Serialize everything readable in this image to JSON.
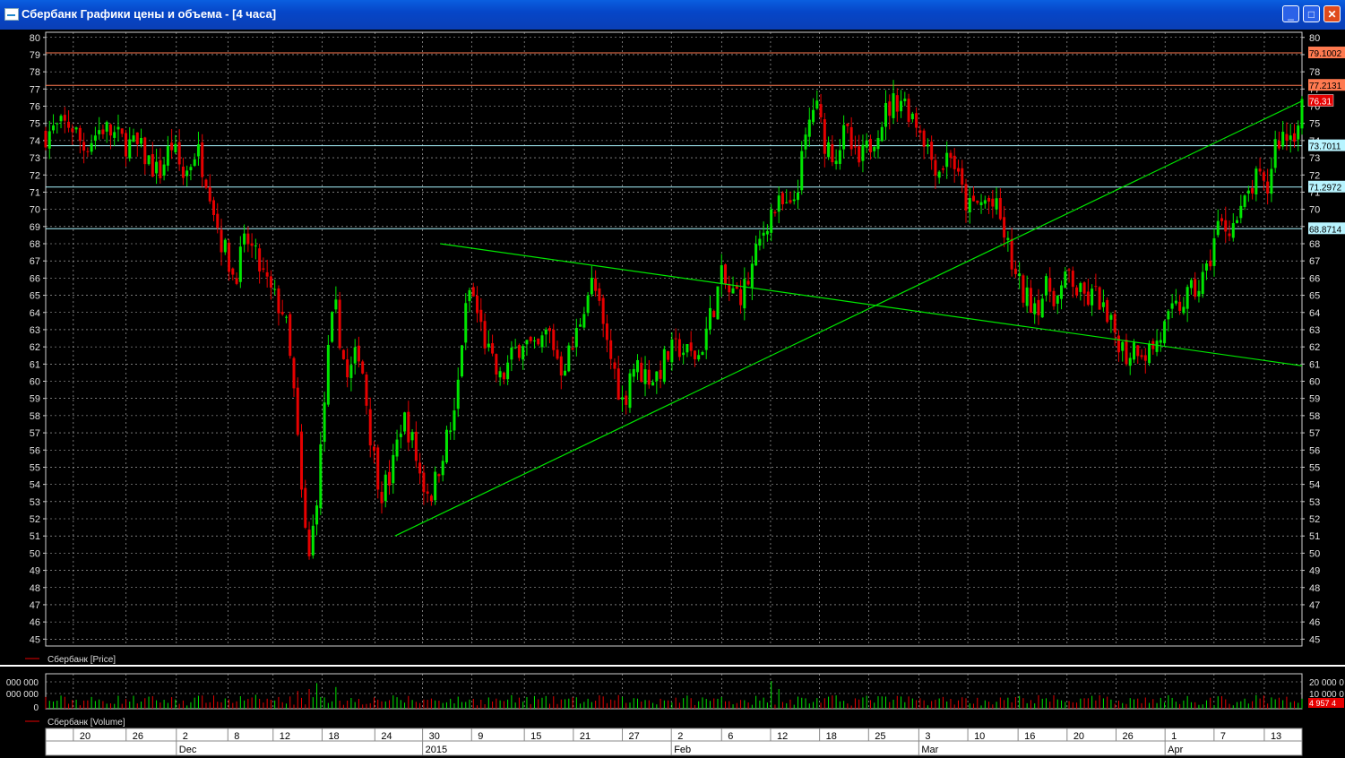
{
  "window": {
    "title": "Сбербанк Графики цены и объема - [4 часа]"
  },
  "colors": {
    "up": "#00e600",
    "down": "#e60000",
    "trendline": "#00e600",
    "grid": "#c0c0c0",
    "resistance": "#ff7a50",
    "support": "#aaf5ff"
  },
  "chart_data": [
    {
      "type": "candlestick",
      "series_name": "Сбербанк [Price]",
      "ylim": [
        44.6,
        80.3
      ],
      "y_ticks": [
        45,
        46,
        47,
        48,
        49,
        50,
        51,
        52,
        53,
        54,
        55,
        56,
        57,
        58,
        59,
        60,
        61,
        62,
        63,
        64,
        65,
        66,
        67,
        68,
        69,
        70,
        71,
        72,
        73,
        74,
        75,
        76,
        77,
        78,
        79,
        80
      ],
      "x_ticks": [
        {
          "label": "20",
          "sub": "",
          "frac": 0.022
        },
        {
          "label": "26",
          "sub": "",
          "frac": 0.064
        },
        {
          "label": "2",
          "sub": "Dec",
          "frac": 0.104
        },
        {
          "label": "8",
          "sub": "",
          "frac": 0.145
        },
        {
          "label": "12",
          "sub": "",
          "frac": 0.181
        },
        {
          "label": "18",
          "sub": "",
          "frac": 0.22
        },
        {
          "label": "24",
          "sub": "",
          "frac": 0.262
        },
        {
          "label": "30",
          "sub": "2015",
          "frac": 0.3
        },
        {
          "label": "9",
          "sub": "",
          "frac": 0.339
        },
        {
          "label": "15",
          "sub": "",
          "frac": 0.381
        },
        {
          "label": "21",
          "sub": "",
          "frac": 0.42
        },
        {
          "label": "27",
          "sub": "",
          "frac": 0.459
        },
        {
          "label": "2",
          "sub": "Feb",
          "frac": 0.498
        },
        {
          "label": "6",
          "sub": "",
          "frac": 0.538
        },
        {
          "label": "12",
          "sub": "",
          "frac": 0.577
        },
        {
          "label": "18",
          "sub": "",
          "frac": 0.616
        },
        {
          "label": "25",
          "sub": "",
          "frac": 0.655
        },
        {
          "label": "3",
          "sub": "Mar",
          "frac": 0.695
        },
        {
          "label": "10",
          "sub": "",
          "frac": 0.734
        },
        {
          "label": "16",
          "sub": "",
          "frac": 0.774
        },
        {
          "label": "20",
          "sub": "",
          "frac": 0.813
        },
        {
          "label": "26",
          "sub": "",
          "frac": 0.852
        },
        {
          "label": "1",
          "sub": "Apr",
          "frac": 0.891
        },
        {
          "label": "7",
          "sub": "",
          "frac": 0.93
        },
        {
          "label": "13",
          "sub": "",
          "frac": 0.97
        }
      ],
      "path_points": [
        [
          0,
          74.4
        ],
        [
          0.02,
          75
        ],
        [
          0.03,
          73.6
        ],
        [
          0.045,
          74.8
        ],
        [
          0.06,
          74
        ],
        [
          0.075,
          73.5
        ],
        [
          0.09,
          72
        ],
        [
          0.1,
          73.8
        ],
        [
          0.11,
          71.8
        ],
        [
          0.12,
          73.6
        ],
        [
          0.13,
          71.5
        ],
        [
          0.138,
          68.6
        ],
        [
          0.15,
          66
        ],
        [
          0.16,
          68.3
        ],
        [
          0.18,
          65
        ],
        [
          0.19,
          64
        ],
        [
          0.198,
          59
        ],
        [
          0.205,
          52
        ],
        [
          0.21,
          49.5
        ],
        [
          0.218,
          55
        ],
        [
          0.224,
          61
        ],
        [
          0.23,
          64.5
        ],
        [
          0.24,
          60
        ],
        [
          0.25,
          62
        ],
        [
          0.26,
          56
        ],
        [
          0.267,
          53.6
        ],
        [
          0.275,
          54.5
        ],
        [
          0.284,
          58
        ],
        [
          0.29,
          57
        ],
        [
          0.3,
          54
        ],
        [
          0.308,
          53.5
        ],
        [
          0.316,
          56
        ],
        [
          0.326,
          58
        ],
        [
          0.332,
          63
        ],
        [
          0.338,
          65.5
        ],
        [
          0.345,
          63.5
        ],
        [
          0.355,
          61
        ],
        [
          0.362,
          60
        ],
        [
          0.372,
          61.5
        ],
        [
          0.38,
          62.5
        ],
        [
          0.39,
          61.5
        ],
        [
          0.4,
          63
        ],
        [
          0.41,
          60.8
        ],
        [
          0.42,
          62
        ],
        [
          0.43,
          65
        ],
        [
          0.436,
          65.8
        ],
        [
          0.445,
          62.5
        ],
        [
          0.452,
          60.8
        ],
        [
          0.46,
          58.5
        ],
        [
          0.466,
          61
        ],
        [
          0.475,
          60.5
        ],
        [
          0.485,
          60.2
        ],
        [
          0.495,
          61.5
        ],
        [
          0.505,
          62
        ],
        [
          0.512,
          61.5
        ],
        [
          0.52,
          61.5
        ],
        [
          0.53,
          64
        ],
        [
          0.538,
          66
        ],
        [
          0.545,
          65
        ],
        [
          0.555,
          65.2
        ],
        [
          0.56,
          66
        ],
        [
          0.568,
          68
        ],
        [
          0.576,
          69.8
        ],
        [
          0.585,
          70.2
        ],
        [
          0.593,
          69.8
        ],
        [
          0.6,
          72
        ],
        [
          0.607,
          74.8
        ],
        [
          0.612,
          76.3
        ],
        [
          0.62,
          74
        ],
        [
          0.628,
          73.2
        ],
        [
          0.637,
          74.5
        ],
        [
          0.646,
          72.5
        ],
        [
          0.655,
          73.6
        ],
        [
          0.662,
          74.8
        ],
        [
          0.67,
          75.8
        ],
        [
          0.68,
          76.6
        ],
        [
          0.69,
          75.5
        ],
        [
          0.698,
          74.5
        ],
        [
          0.705,
          73
        ],
        [
          0.712,
          72.3
        ],
        [
          0.72,
          73.5
        ],
        [
          0.728,
          71.2
        ],
        [
          0.735,
          70
        ],
        [
          0.742,
          70.3
        ],
        [
          0.75,
          70.5
        ],
        [
          0.758,
          69.8
        ],
        [
          0.765,
          68
        ],
        [
          0.772,
          66
        ],
        [
          0.78,
          64.8
        ],
        [
          0.79,
          64.6
        ],
        [
          0.798,
          65.5
        ],
        [
          0.806,
          64.8
        ],
        [
          0.815,
          66.3
        ],
        [
          0.822,
          65
        ],
        [
          0.83,
          64.8
        ],
        [
          0.838,
          65
        ],
        [
          0.845,
          63.3
        ],
        [
          0.852,
          62.8
        ],
        [
          0.86,
          61.5
        ],
        [
          0.868,
          62.2
        ],
        [
          0.876,
          61.7
        ],
        [
          0.884,
          62.2
        ],
        [
          0.89,
          63
        ],
        [
          0.9,
          64.2
        ],
        [
          0.91,
          65
        ],
        [
          0.918,
          65.5
        ],
        [
          0.925,
          66.5
        ],
        [
          0.932,
          69
        ],
        [
          0.94,
          69
        ],
        [
          0.95,
          69.4
        ],
        [
          0.958,
          71
        ],
        [
          0.965,
          71.8
        ],
        [
          0.972,
          70.8
        ],
        [
          0.978,
          73.8
        ],
        [
          0.985,
          74.3
        ],
        [
          0.993,
          74.3
        ],
        [
          1,
          76.3
        ]
      ],
      "horizontal_lines": [
        {
          "value": 79.1002,
          "label": "79.1002",
          "kind": "resistance"
        },
        {
          "value": 77.2131,
          "label": "77.2131",
          "kind": "resistance"
        },
        {
          "value": 73.7011,
          "label": "73.7011",
          "kind": "support"
        },
        {
          "value": 71.2972,
          "label": "71.2972",
          "kind": "support"
        },
        {
          "value": 68.8714,
          "label": "68.8714",
          "kind": "support"
        }
      ],
      "current_price": {
        "value": 76.31,
        "label": "76.31"
      },
      "trendlines": [
        {
          "from": [
            0.278,
            51.0
          ],
          "to": [
            1.0,
            76.3
          ]
        },
        {
          "from": [
            0.314,
            68.0
          ],
          "to": [
            1.0,
            60.9
          ]
        }
      ]
    },
    {
      "type": "bar",
      "series_name": "Сбербанк [Volume]",
      "y_ticks_left": [
        "000 000",
        "000 000",
        "0"
      ],
      "y_ticks_right": [
        "20 000 0",
        "10 000 0"
      ],
      "last_value_label": "4 957 4"
    }
  ]
}
